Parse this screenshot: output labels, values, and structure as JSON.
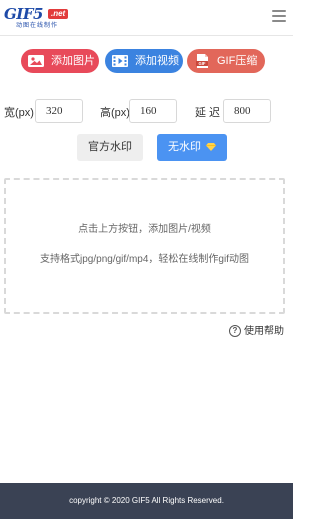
{
  "header": {
    "logo_main": "GIF5",
    "logo_badge": ".net",
    "logo_sub": "动图在线制作",
    "menu_icon": "hamburger-menu-icon"
  },
  "actions": {
    "add_image": {
      "label": "添加图片",
      "color": "#e84a5a",
      "icon": "image-icon"
    },
    "add_video": {
      "label": "添加视频",
      "color": "#3b83e0",
      "icon": "film-icon"
    },
    "gif_compress": {
      "label": "GIF压缩",
      "color": "#e2675a",
      "icon": "gif-file-icon"
    }
  },
  "params": {
    "width_label": "宽(px)",
    "width_value": "320",
    "height_label": "高(px)",
    "height_value": "160",
    "delay_label": "延迟",
    "delay_value": "800"
  },
  "watermark": {
    "official_label": "官方水印",
    "none_label": "无水印",
    "selected": "无水印",
    "none_icon": "diamond-icon"
  },
  "dropzone": {
    "line1": "点击上方按钮，添加图片/视频",
    "line2": "支持格式jpg/png/gif/mp4，轻松在线制作gif动图"
  },
  "help": {
    "label": "使用帮助",
    "icon": "question-circle-icon"
  },
  "footer": {
    "copyright": "copyright © 2020 GIF5 All Rights Reserved."
  }
}
